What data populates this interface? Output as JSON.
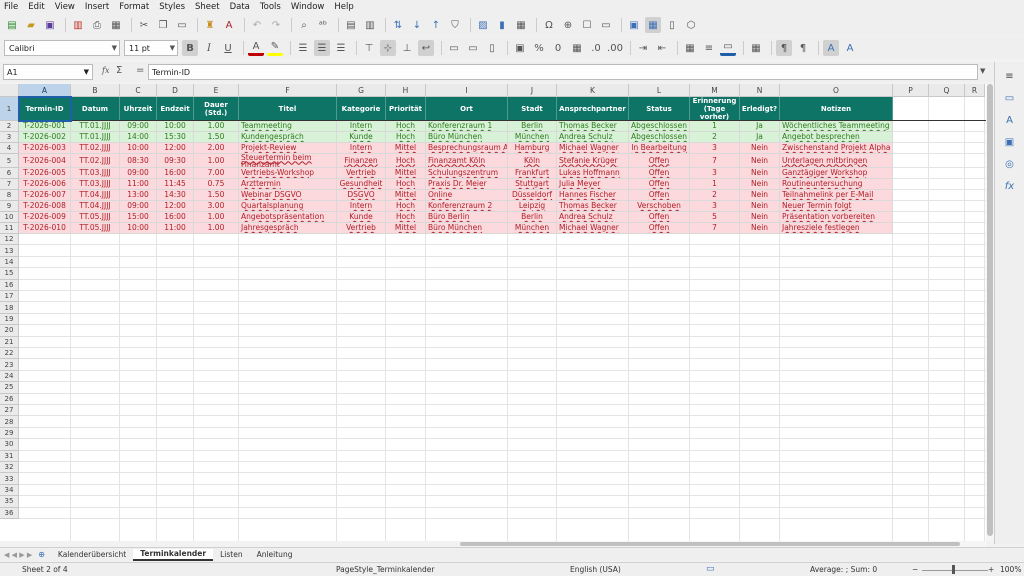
{
  "menu": [
    "File",
    "Edit",
    "View",
    "Insert",
    "Format",
    "Styles",
    "Sheet",
    "Data",
    "Tools",
    "Window",
    "Help"
  ],
  "font": {
    "name": "Calibri",
    "size": "11 pt"
  },
  "formula": {
    "cell_ref": "A1",
    "content": "Termin-ID",
    "fx": "fx",
    "sigma": "Σ",
    "equals": "="
  },
  "columns": [
    {
      "letter": "A",
      "header": "Termin-ID"
    },
    {
      "letter": "B",
      "header": "Datum"
    },
    {
      "letter": "C",
      "header": "Uhrzeit"
    },
    {
      "letter": "D",
      "header": "Endzeit"
    },
    {
      "letter": "E",
      "header": "Dauer (Std.)"
    },
    {
      "letter": "F",
      "header": "Titel"
    },
    {
      "letter": "G",
      "header": "Kategorie"
    },
    {
      "letter": "H",
      "header": "Priorität"
    },
    {
      "letter": "I",
      "header": "Ort"
    },
    {
      "letter": "J",
      "header": "Stadt"
    },
    {
      "letter": "K",
      "header": "Ansprechpartner"
    },
    {
      "letter": "L",
      "header": "Status"
    },
    {
      "letter": "M",
      "header": "Erinnerung (Tage vorher)"
    },
    {
      "letter": "N",
      "header": "Erledigt?"
    },
    {
      "letter": "O",
      "header": "Notizen"
    },
    {
      "letter": "P",
      "header": ""
    },
    {
      "letter": "Q",
      "header": ""
    },
    {
      "letter": "R",
      "header": ""
    }
  ],
  "rows": [
    {
      "color": "green",
      "cells": [
        "T-2026-001",
        "TT.01.JJJJ",
        "09:00",
        "10:00",
        "1.00",
        "Teammeeting",
        "Intern",
        "Hoch",
        "Konferenzraum 1",
        "Berlin",
        "Thomas Becker",
        "Abgeschlossen",
        "1",
        "Ja",
        "Wöchentliches Teammeeting"
      ]
    },
    {
      "color": "green",
      "cells": [
        "T-2026-002",
        "TT.01.JJJJ",
        "14:00",
        "15:30",
        "1.50",
        "Kundengespräch",
        "Kunde",
        "Hoch",
        "Büro München",
        "München",
        "Andrea Schulz",
        "Abgeschlossen",
        "2",
        "Ja",
        "Angebot besprechen"
      ]
    },
    {
      "color": "red",
      "cells": [
        "T-2026-003",
        "TT.02.JJJJ",
        "10:00",
        "12:00",
        "2.00",
        "Projekt-Review",
        "Intern",
        "Mittel",
        "Besprechungsraum A",
        "Hamburg",
        "Michael Wagner",
        "In Bearbeitung",
        "3",
        "Nein",
        "Zwischenstand Projekt Alpha"
      ]
    },
    {
      "color": "red",
      "cells": [
        "T-2026-004",
        "TT.02.JJJJ",
        "08:30",
        "09:30",
        "1.00",
        "Steuertermin beim Finanzamt",
        "Finanzen",
        "Hoch",
        "Finanzamt Köln",
        "Köln",
        "Stefanie Krüger",
        "Offen",
        "7",
        "Nein",
        "Unterlagen mitbringen"
      ]
    },
    {
      "color": "red",
      "cells": [
        "T-2026-005",
        "TT.03.JJJJ",
        "09:00",
        "16:00",
        "7.00",
        "Vertriebs-Workshop",
        "Vertrieb",
        "Mittel",
        "Schulungszentrum",
        "Frankfurt",
        "Lukas Hoffmann",
        "Offen",
        "3",
        "Nein",
        "Ganztägiger Workshop"
      ]
    },
    {
      "color": "red",
      "cells": [
        "T-2026-006",
        "TT.03.JJJJ",
        "11:00",
        "11:45",
        "0.75",
        "Arzttermin",
        "Gesundheit",
        "Hoch",
        "Praxis Dr. Meier",
        "Stuttgart",
        "Julia Meyer",
        "Offen",
        "1",
        "Nein",
        "Routineuntersuchung"
      ]
    },
    {
      "color": "red",
      "cells": [
        "T-2026-007",
        "TT.04.JJJJ",
        "13:00",
        "14:30",
        "1.50",
        "Webinar DSGVO",
        "DSGVO",
        "Mittel",
        "Online",
        "Düsseldorf",
        "Hannes Fischer",
        "Offen",
        "2",
        "Nein",
        "Teilnahmelink per E-Mail"
      ]
    },
    {
      "color": "red",
      "cells": [
        "T-2026-008",
        "TT.04.JJJJ",
        "09:00",
        "12:00",
        "3.00",
        "Quartalsplanung",
        "Intern",
        "Hoch",
        "Konferenzraum 2",
        "Leipzig",
        "Thomas Becker",
        "Verschoben",
        "3",
        "Nein",
        "Neuer Termin folgt"
      ]
    },
    {
      "color": "red",
      "cells": [
        "T-2026-009",
        "TT.05.JJJJ",
        "15:00",
        "16:00",
        "1.00",
        "Angebotspräsentation",
        "Kunde",
        "Hoch",
        "Büro Berlin",
        "Berlin",
        "Andrea Schulz",
        "Offen",
        "5",
        "Nein",
        "Präsentation vorbereiten"
      ]
    },
    {
      "color": "red",
      "cells": [
        "T-2026-010",
        "TT.05.JJJJ",
        "10:00",
        "11:00",
        "1.00",
        "Jahresgespräch",
        "Vertrieb",
        "Mittel",
        "Büro München",
        "München",
        "Michael Wagner",
        "Offen",
        "7",
        "Nein",
        "Jahresziele festlegen"
      ]
    }
  ],
  "tabs": [
    "Kalenderübersicht",
    "Terminkalender",
    "Listen",
    "Anleitung"
  ],
  "active_tab": "Terminkalender",
  "status": {
    "sheet": "Sheet 2 of 4",
    "style": "PageStyle_Terminkalender",
    "lang": "English (USA)",
    "sum": "Average: ; Sum: 0",
    "zoom": "100%"
  },
  "colors": {
    "header": "#0e7466",
    "green_row": "#d7f2d7",
    "red_row": "#fbd9dc",
    "selection": "#1f5fa8"
  }
}
